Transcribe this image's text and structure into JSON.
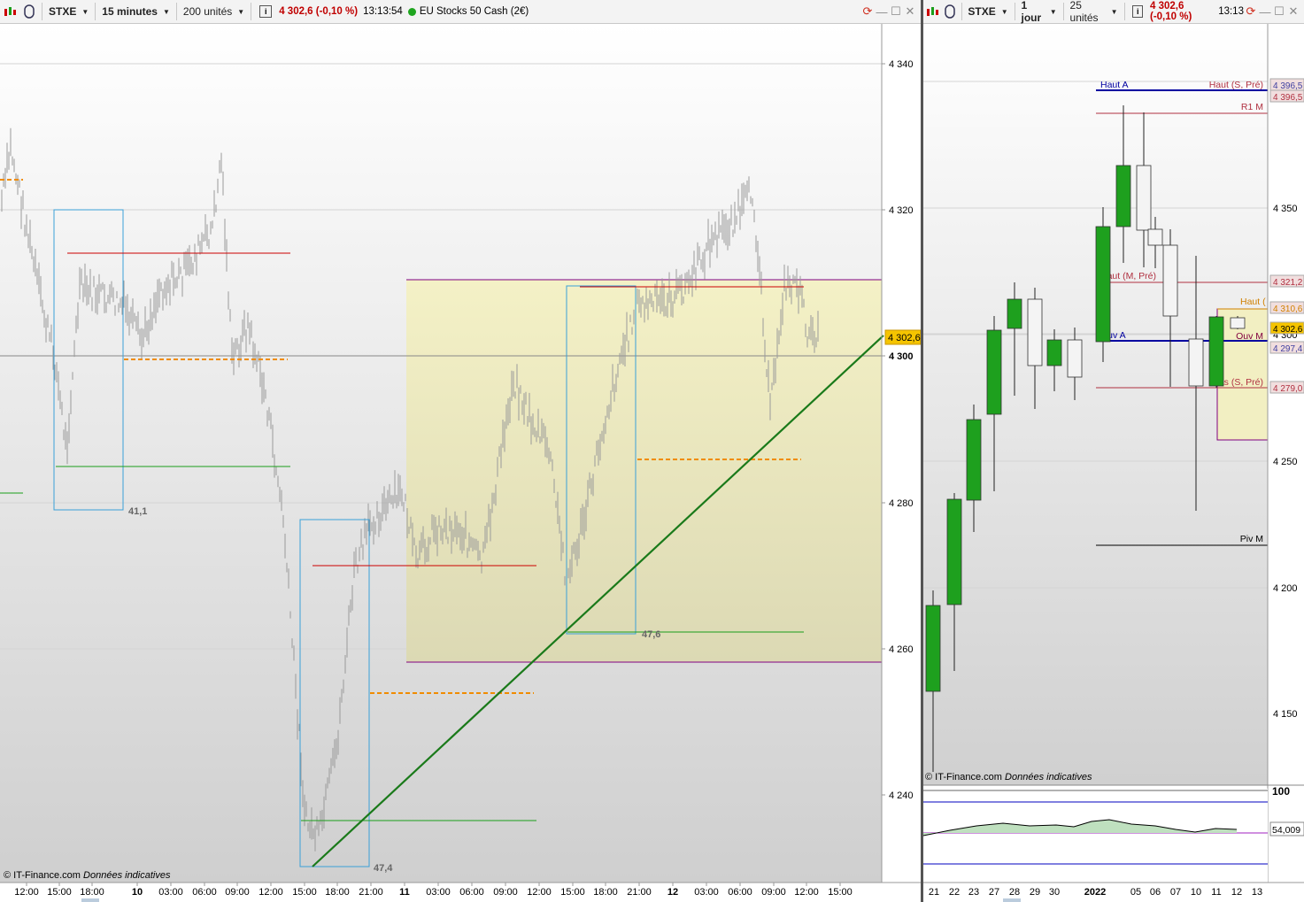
{
  "left": {
    "toolbar": {
      "symbol": "STXE",
      "timeframe": "15 minutes",
      "units": "200 unités",
      "last": "4 302,6 (-0,10 %)",
      "time": "13:13:54",
      "name": "EU Stocks 50 Cash (2€)"
    },
    "axis": {
      "y_ticks": [
        "4 340",
        "4 320",
        "4 300",
        "4 280",
        "4 260",
        "4 240"
      ],
      "x_ticks": [
        "12:00",
        "15:00",
        "18:00",
        "10",
        "03:00",
        "06:00",
        "09:00",
        "12:00",
        "15:00",
        "18:00",
        "21:00",
        "11",
        "03:00",
        "06:00",
        "09:00",
        "12:00",
        "15:00",
        "18:00",
        "21:00",
        "12",
        "03:00",
        "06:00",
        "09:00",
        "12:00",
        "15:00"
      ],
      "price_label": "4 302,6"
    },
    "box_labels": [
      "41,1",
      "47,4",
      "47,6"
    ],
    "copyright": "© IT-Finance.com",
    "copyright_note": "Données indicatives"
  },
  "right": {
    "toolbar": {
      "symbol": "STXE",
      "timeframe": "1 jour",
      "units": "25 unités",
      "last": "4 302,6 (-0,10 %)",
      "time": "13:13"
    },
    "axis": {
      "y_ticks": [
        "4 350",
        "4 300",
        "4 250",
        "4 200",
        "4 150"
      ],
      "x_ticks": [
        "21",
        "22",
        "23",
        "27",
        "28",
        "29",
        "30",
        "2022",
        "05",
        "06",
        "07",
        "10",
        "11",
        "12",
        "13"
      ],
      "price_labels": [
        {
          "text": "4 396,5",
          "color": "#4040a0"
        },
        {
          "text": "4 396,5",
          "color": "#b03040"
        },
        {
          "text": "4 321,2",
          "color": "#b03040"
        },
        {
          "text": "4 310,6",
          "color": "#d08000"
        },
        {
          "text": "4 302,6",
          "color": "#000000"
        },
        {
          "text": "4 297,4",
          "color": "#4040a0"
        },
        {
          "text": "4 279,0",
          "color": "#b03040"
        }
      ]
    },
    "levels": [
      "Haut A",
      "Haut (S, Pré)",
      "R1 M",
      "Haut (M, Pré)",
      "Ouv A",
      "Ouv M",
      "Bas (S, Pré)",
      "Piv M",
      "Haut ("
    ],
    "copyright": "© IT-Finance.com",
    "copyright_note": "Données indicatives",
    "indicator": {
      "upper": "100",
      "value": "54,009"
    }
  },
  "colors": {
    "up": "#1ea01e",
    "down": "#f4f4f4",
    "trend": "#1a7a1a",
    "box": "#3aa0d8",
    "zone": "#f2efc2"
  }
}
